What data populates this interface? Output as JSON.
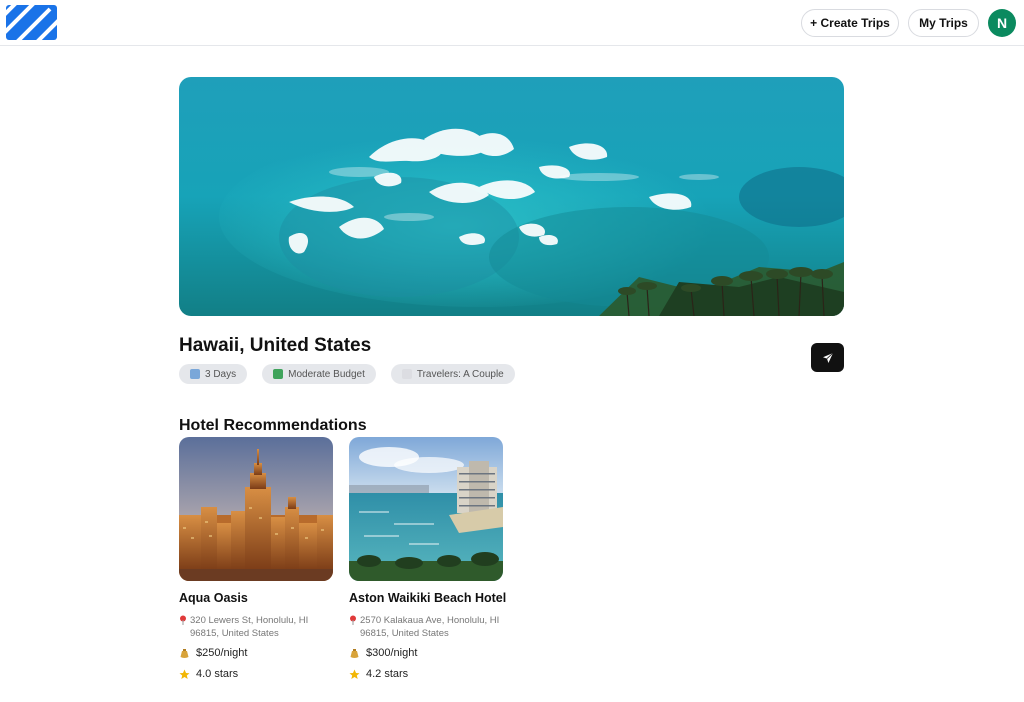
{
  "header": {
    "logo_icon": "brand-logo-icon",
    "create_trips_label": "+ Create Trips",
    "my_trips_label": "My Trips",
    "avatar_initial": "N"
  },
  "destination": {
    "title": "Hawaii, United States",
    "chips": {
      "days": "3 Days",
      "budget": "Moderate Budget",
      "travelers": "Travelers: A Couple"
    },
    "share_icon": "paper-plane-icon"
  },
  "hotels": {
    "section_title": "Hotel Recommendations",
    "items": [
      {
        "name": "Aqua Oasis",
        "address": "320 Lewers St, Honolulu, HI 96815, United States",
        "price": "$250/night",
        "rating": "4.0 stars"
      },
      {
        "name": "Aston Waikiki Beach Hotel",
        "address": "2570 Kalakaua Ave, Honolulu, HI 96815, United States",
        "price": "$300/night",
        "rating": "4.2 stars"
      }
    ]
  },
  "colors": {
    "accent_logo": "#1a73e8",
    "avatar_bg": "#0b8a5f",
    "chip_bg": "#e5e7eb",
    "share_btn_bg": "#111111"
  }
}
